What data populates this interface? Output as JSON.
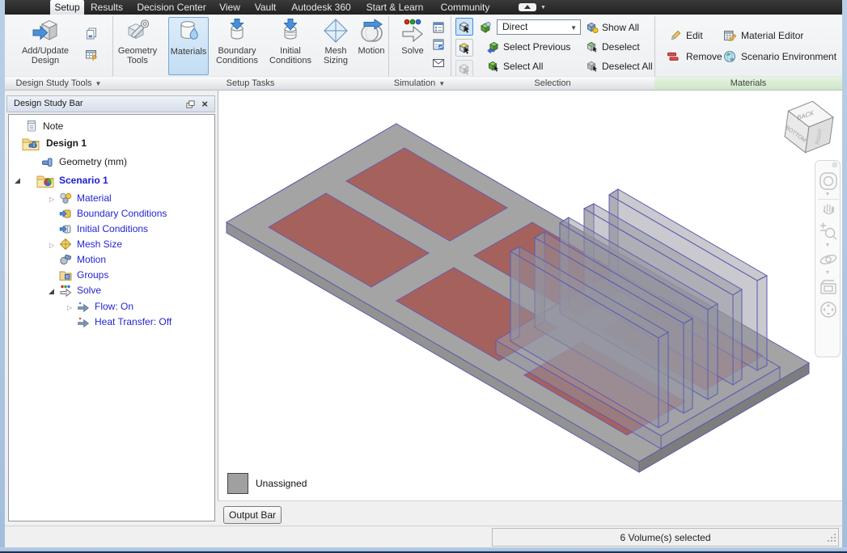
{
  "menubar": {
    "active_tab": "Setup",
    "tabs": [
      {
        "label": "Setup"
      },
      {
        "label": "Results"
      },
      {
        "label": "Decision Center"
      },
      {
        "label": "View"
      },
      {
        "label": "Vault"
      },
      {
        "label": "Autodesk 360"
      },
      {
        "label": "Start & Learn"
      },
      {
        "label": "Community"
      }
    ]
  },
  "ribbon": {
    "design_study_tools": {
      "group_label": "Design Study Tools",
      "add_update_label": "Add/Update Design"
    },
    "setup_tasks": {
      "group_label": "Setup Tasks",
      "buttons": [
        {
          "label": "Geometry Tools"
        },
        {
          "label": "Materials",
          "active": true
        },
        {
          "label": "Boundary Conditions"
        },
        {
          "label": "Initial Conditions"
        },
        {
          "label": "Mesh Sizing"
        },
        {
          "label": "Motion"
        }
      ]
    },
    "simulation": {
      "group_label": "Simulation",
      "solve_label": "Solve"
    },
    "selection": {
      "group_label": "Selection",
      "mode_value": "Direct",
      "show_all": "Show All",
      "select_previous": "Select Previous",
      "deselect": "Deselect",
      "select_all": "Select All",
      "deselect_all": "Deselect All"
    },
    "materials": {
      "group_label": "Materials",
      "edit": "Edit",
      "remove": "Remove",
      "material_editor": "Material Editor",
      "scenario_environment": "Scenario Environment"
    }
  },
  "design_study_bar": {
    "title": "Design Study Bar",
    "tree": {
      "items": [
        {
          "label": "Note"
        },
        {
          "label": "Design 1"
        },
        {
          "label": "Geometry (mm)"
        },
        {
          "label": "Scenario 1"
        },
        {
          "label": "Material"
        },
        {
          "label": "Boundary Conditions"
        },
        {
          "label": "Initial Conditions"
        },
        {
          "label": "Mesh Size"
        },
        {
          "label": "Motion"
        },
        {
          "label": "Groups"
        },
        {
          "label": "Solve"
        },
        {
          "label": "Flow: On"
        },
        {
          "label": "Heat Transfer: Off"
        }
      ]
    }
  },
  "viewport": {
    "legend": {
      "label": "Unassigned",
      "swatch_color": "#a0a0a0"
    },
    "viewcube": {
      "top_face": "BACK",
      "left_face": "BOTTOM",
      "right_face": "RIGHT"
    },
    "colors": {
      "board": "#a4a4a4",
      "die": "#a5625c",
      "edge": "#5d5dab",
      "selection_highlight": "#cfe3f7"
    }
  },
  "output_bar": {
    "label": "Output Bar"
  },
  "status_bar": {
    "message": "6 Volume(s) selected"
  }
}
